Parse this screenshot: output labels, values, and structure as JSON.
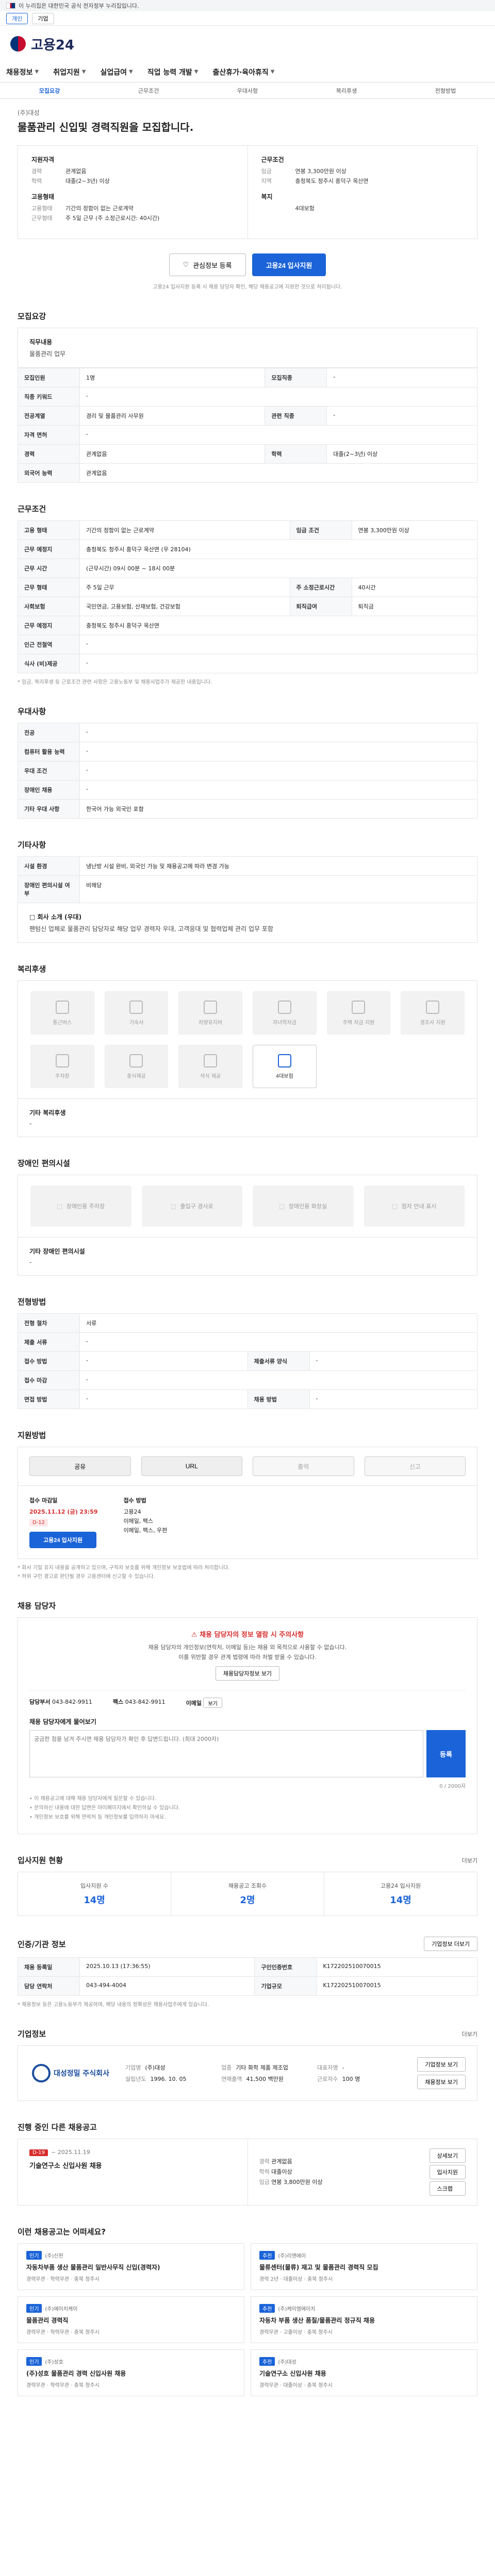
{
  "gov_bar": {
    "text": "이 누리집은 대한민국 공식 전자정부 누리집입니다."
  },
  "util": {
    "btn1": "개인",
    "btn2": "기업"
  },
  "brand": {
    "name": "고용24"
  },
  "gnb": [
    "채용정보",
    "취업지원",
    "실업급여",
    "직업 능력 개발",
    "출산휴가·육아휴직"
  ],
  "subtabs": [
    "모집요강",
    "근무조건",
    "우대사항",
    "복리후생",
    "전형방법"
  ],
  "job": {
    "company": "(주)대성",
    "title": "물품관리 신입및 경력직원을 모집합니다."
  },
  "summary": {
    "left_title1": "지원자격",
    "left_kv1": [
      {
        "k": "경력",
        "v": "관계없음"
      },
      {
        "k": "학력",
        "v": "대졸(2~3년) 이상"
      }
    ],
    "left_title2": "고용형태",
    "left_kv2": [
      {
        "k": "고용형태",
        "v": "기간의 정함이 없는 근로계약"
      },
      {
        "k": "근무형태",
        "v": "주 5일 근무 (주 소정근로시간: 40시간)"
      }
    ],
    "right_title1": "근무조건",
    "right_kv1": [
      {
        "k": "임금",
        "v": "연봉 3,300만원 이상"
      },
      {
        "k": "지역",
        "v": "충청북도 청주시 흥덕구 옥산면"
      }
    ],
    "right_title2": "복지",
    "right_kv2": [
      {
        "k": "",
        "v": "4대보험"
      }
    ]
  },
  "actions": {
    "scrap": "관심정보 등록",
    "apply": "고용24 입사지원",
    "note": "고용24 입사지원 등록 시 채용 담당자 확인, 해당 채용공고에 지원한 것으로 처리됩니다."
  },
  "recruit": {
    "title": "모집요강",
    "duty_label": "직무내용",
    "duty_text": "물품관리 업무",
    "rows": [
      {
        "k1": "모집인원",
        "v1": "1명",
        "k2": "모집직종",
        "v2": "-"
      },
      {
        "k1": "직종 키워드",
        "v1": "-",
        "k2": "",
        "v2": ""
      },
      {
        "k1": "전공계열",
        "v1": "경리 및 물품관리 사무원",
        "k2": "관련 직종",
        "v2": "-"
      },
      {
        "k1": "자격 면허",
        "v1": "-",
        "k2": "",
        "v2": ""
      },
      {
        "k1": "경력",
        "v1": "관계없음",
        "k2": "학력",
        "v2": "대졸(2~3년) 이상"
      },
      {
        "k1": "외국어 능력",
        "v1": "관계없음",
        "k2": "",
        "v2": ""
      }
    ]
  },
  "work": {
    "title": "근무조건",
    "rows": [
      {
        "k1": "고용 형태",
        "v1": "기간의 정함이 없는 근로계약",
        "k2": "임금 조건",
        "v2": "연봉 3,300만원 이상"
      },
      {
        "k1": "근무 예정지",
        "v1": "충청북도 청주시 흥덕구 옥산면 (우 28104)",
        "k2": "",
        "v2": ""
      },
      {
        "k1": "근무 시간",
        "v1": "(근무시간) 09시 00분 ~ 18시 00분",
        "k2": "",
        "v2": ""
      },
      {
        "k1": "근무 형태",
        "v1": "주 5일 근무",
        "k2": "주 소정근로시간",
        "v2": "40시간"
      },
      {
        "k1": "사회보험",
        "v1": "국민연금, 고용보험, 산재보험, 건강보험",
        "k2": "퇴직급여",
        "v2": "퇴직금"
      },
      {
        "k1": "근무 예정지",
        "v1": "충청북도 청주시 흥덕구 옥산면",
        "k2": "",
        "v2": ""
      },
      {
        "k1": "인근 전철역",
        "v1": "-",
        "k2": "",
        "v2": ""
      },
      {
        "k1": "식사 (비)제공",
        "v1": "-",
        "k2": "",
        "v2": ""
      }
    ],
    "note": "* 임금, 복리후생 등 근로조건 관련 사항은 고용노동부 및 채용사업주가 제공한 내용입니다."
  },
  "pref": {
    "title": "우대사항",
    "rows": [
      {
        "k": "전공",
        "v": "-"
      },
      {
        "k": "컴퓨터 활용 능력",
        "v": "-"
      },
      {
        "k": "우대 조건",
        "v": "-"
      },
      {
        "k": "장애인 채용",
        "v": "-"
      },
      {
        "k": "기타 우대 사항",
        "v": "한국어 가능 외국인 포함"
      }
    ]
  },
  "etc": {
    "title": "기타사항",
    "rows": [
      {
        "k": "시설 환경",
        "v": "냉난방 시설 완비, 외국인 가능 및 채용공고에 따라 변경 가능"
      },
      {
        "k": "장애인 편의시설 여부",
        "v": "비해당"
      }
    ],
    "desc_label": "□ 회사 소개 (우대)",
    "desc_text": "팬텀신 업체로 물품관리 담당자로 해당 업무 경력자 우대, 고객응대 및 협력업체 관리 업무 포함"
  },
  "welfare": {
    "title": "복리후생",
    "items": [
      "통근버스",
      "기숙사",
      "차량유지비",
      "자녀학자금",
      "주택 자금 지원",
      "경조사 지원",
      "주차장",
      "중식제공",
      "석식 제공",
      "4대보험"
    ],
    "note_title": "기타 복리후생",
    "note_text": "-"
  },
  "disability": {
    "title": "장애인 편의시설",
    "items": [
      "장애인용 주차장",
      "출입구 경사로",
      "장애인용 화장실",
      "점자 안내 표시"
    ],
    "note_title": "기타 장애인 편의시설",
    "note_text": "-"
  },
  "screening": {
    "title": "전형방법",
    "rows": [
      {
        "k1": "전형 절차",
        "v1": "서류",
        "k2": "",
        "v2": ""
      },
      {
        "k1": "제출 서류",
        "v1": "-",
        "k2": "",
        "v2": ""
      },
      {
        "k1": "접수 방법",
        "v1": "-",
        "k2": "제출서류 양식",
        "v2": "-"
      },
      {
        "k1": "접수 마감",
        "v1": "-",
        "k2": "",
        "v2": ""
      },
      {
        "k1": "면접 방법",
        "v1": "-",
        "k2": "채용 방법",
        "v2": "-"
      }
    ]
  },
  "apply": {
    "title": "지원방법",
    "shares": [
      "공유",
      "URL",
      "출력",
      "신고"
    ],
    "deadline_label": "접수 마감일",
    "deadline": "2025.11.12 (금) 23:59",
    "dday": "D-12",
    "apply_btn": "고용24 입사지원",
    "method_label": "접수 방법",
    "method1": "고용24",
    "method2": "이메일, 팩스",
    "method3": "이메일, 팩스, 우편",
    "notes": [
      "* 회사 기밀 유지 내용을 공개하고 있으며, 구직자 보호를 위해 개인정보 보호법에 따라 처리합니다.",
      "* 허위 구인 광고로 판단될 경우 고용센터에 신고할 수 있습니다."
    ]
  },
  "contact": {
    "title": "채용 담당자",
    "notice_title": "채용 담당자의 정보 열람 시 주의사항",
    "notice_lines": [
      "채용 담당자의 개인정보(연락처, 이메일 등)는 채용 외 목적으로 사용할 수 없습니다.",
      "이를 위반할 경우 관계 법령에 따라 처벌 받을 수 있습니다."
    ],
    "view_btn": "채용담당자정보 보기",
    "row": [
      {
        "k": "담당부서",
        "v": "043-842-9911"
      },
      {
        "k": "팩스",
        "v": "043-842-9911"
      },
      {
        "k": "이메일",
        "v": "보기"
      }
    ],
    "ask_title": "채용 담당자에게 물어보기",
    "ask_placeholder": "궁금한 점을 남겨 주시면 채용 담당자가 확인 후 답변드립니다. (최대 2000자)",
    "ask_btn": "등록",
    "ask_count": "0 / 2000자",
    "bullets": [
      "• 이 채용공고에 대해 채용 담당자에게 질문할 수 있습니다.",
      "• 문의하신 내용에 대한 답변은 마이페이지에서 확인하실 수 있습니다.",
      "• 개인정보 보호를 위해 연락처 등 개인정보를 입력하지 마세요."
    ]
  },
  "stats": {
    "title": "입사지원 현황",
    "more": "더보기",
    "items": [
      {
        "t": "입사지원 수",
        "n": "14명"
      },
      {
        "t": "채용공고 조회수",
        "n": "2명"
      },
      {
        "t": "고용24 입사지원",
        "n": "14명"
      }
    ]
  },
  "info": {
    "title": "인증/기관 정보",
    "btn": "기업정보 더보기",
    "rows": [
      {
        "k1": "채용 등록일",
        "v1": "2025.10.13 (17:36:55)",
        "k2": "구인인증번호",
        "v2": "K172202510070015"
      },
      {
        "k1": "담당 연락처",
        "v1": "043-494-4004",
        "k2": "기업규모",
        "v2": "K172202510070015"
      }
    ],
    "note": "* 채용정보 등은 고용노동부가 제공하며, 해당 내용의 정확성은 채용사업주에게 있습니다."
  },
  "company": {
    "title": "기업정보",
    "more": "더보기",
    "logo_text": "대성정밀 주식회사",
    "rows": [
      {
        "k": "기업명",
        "v": "(주)대성"
      },
      {
        "k": "업종",
        "v": "기타 화학 제품 제조업"
      },
      {
        "k": "대표자명",
        "v": "-"
      },
      {
        "k": "설립년도",
        "v": "1996. 10. 05"
      },
      {
        "k": "연매출액",
        "v": "41,500 백만원"
      },
      {
        "k": "근로자수",
        "v": "100 명"
      }
    ],
    "btn1": "기업정보 보기",
    "btn2": "채용정보 보기"
  },
  "ongoing": {
    "title": "진행 중인 다른 채용공고",
    "left_tag": "D-19",
    "left_date": "~ 2025.11.19",
    "left_title": "기술연구소 신입사원 채용",
    "right_items": [
      {
        "k": "경력",
        "v": "관계없음"
      },
      {
        "k": "학력",
        "v": "대졸이상"
      },
      {
        "k": "임금",
        "v": "연봉 3,800만원 이상"
      }
    ],
    "btn1": "상세보기",
    "btn2": "입사지원",
    "btn3": "스크랩"
  },
  "reco": {
    "title": "이런 채용공고는 어떠세요?",
    "cards": [
      {
        "tag": "인기",
        "co": "(주)신한",
        "title": "자동차부품 생산 물품관리 일반사무직 신입(경력자)",
        "meta": "경력무관 · 학력무관 · 충북 청주시"
      },
      {
        "tag": "추천",
        "co": "(주)리앤에이",
        "title": "물류센터(물류) 재고 및 물품관리 경력직 모집",
        "meta": "경력 2년 · 대졸이상 · 충북 청주시"
      },
      {
        "tag": "인기",
        "co": "(주)에이치케이",
        "title": "물품관리 경력직",
        "meta": "경력무관 · 학력무관 · 충북 청주시"
      },
      {
        "tag": "추천",
        "co": "(주)케이엠에이치",
        "title": "자동차 부품 생산 품질/물품관리 정규직 채용",
        "meta": "경력무관 · 고졸이상 · 충북 청주시"
      },
      {
        "tag": "인기",
        "co": "(주)성호",
        "title": "(주)성호 물품관리 경력 신입사원 채용",
        "meta": "경력무관 · 학력무관 · 충북 청주시"
      },
      {
        "tag": "추천",
        "co": "(주)대성",
        "title": "기술연구소 신입사원 채용",
        "meta": "경력무관 · 대졸이상 · 충북 청주시"
      }
    ]
  }
}
